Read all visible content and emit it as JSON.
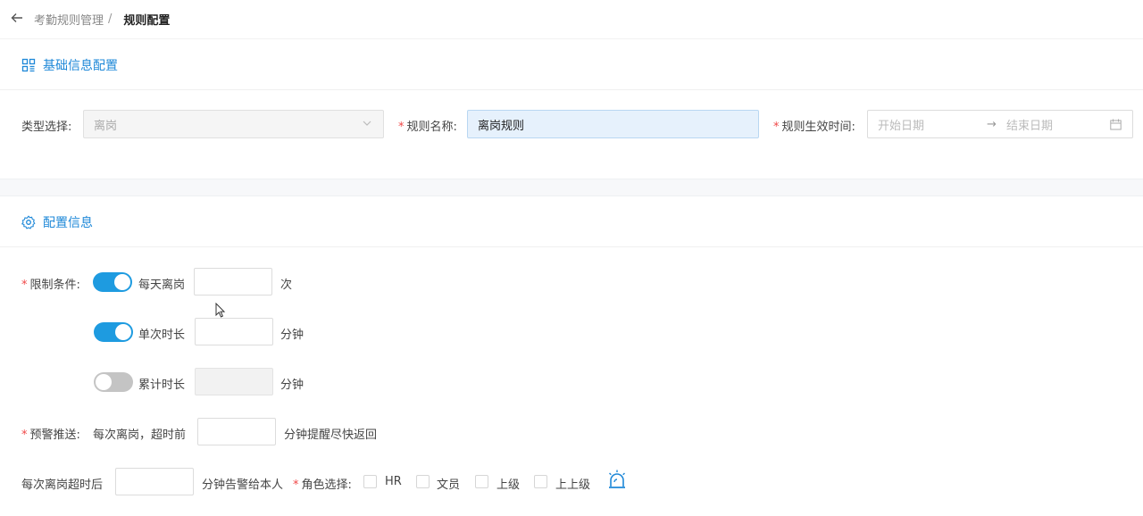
{
  "breadcrumb": {
    "back_icon": "arrow-left-icon",
    "parent": "考勤规则管理",
    "separator": "/",
    "current": "规则配置"
  },
  "section_basic": {
    "icon": "layout-grid-icon",
    "title": "基础信息配置"
  },
  "basic_form": {
    "type_label": "类型选择:",
    "type_value": "离岗",
    "name_label": "规则名称:",
    "name_value": "离岗规则",
    "period_label": "规则生效时间:",
    "start_placeholder": "开始日期",
    "range_arrow": "→",
    "end_placeholder": "结束日期"
  },
  "section_config": {
    "icon": "gear-icon",
    "title": "配置信息"
  },
  "limits": {
    "label": "限制条件:",
    "rows": [
      {
        "name": "每天离岗",
        "enabled": true,
        "value": "",
        "unit": "次"
      },
      {
        "name": "单次时长",
        "enabled": true,
        "value": "",
        "unit": "分钟"
      },
      {
        "name": "累计时长",
        "enabled": false,
        "value": "",
        "unit": "分钟"
      }
    ]
  },
  "warning": {
    "label": "预警推送:",
    "prefix": "每次离岗，超时前",
    "value": "",
    "suffix": "分钟提醒尽快返回"
  },
  "alert": {
    "prefix": "每次离岗超时后",
    "value": "",
    "suffix": "分钟告警给本人",
    "role_label": "角色选择:",
    "roles": [
      {
        "name": "HR",
        "checked": false
      },
      {
        "name": "文员",
        "checked": false
      },
      {
        "name": "上级",
        "checked": false
      },
      {
        "name": "上上级",
        "checked": false
      }
    ],
    "alarm_icon": "alarm-bell-icon"
  },
  "colors": {
    "accent": "#1e88d8",
    "toggle_on": "#1e9be0",
    "toggle_off": "#c4c4c4",
    "required": "#f04848",
    "name_input_bg": "#e6f1fc"
  }
}
